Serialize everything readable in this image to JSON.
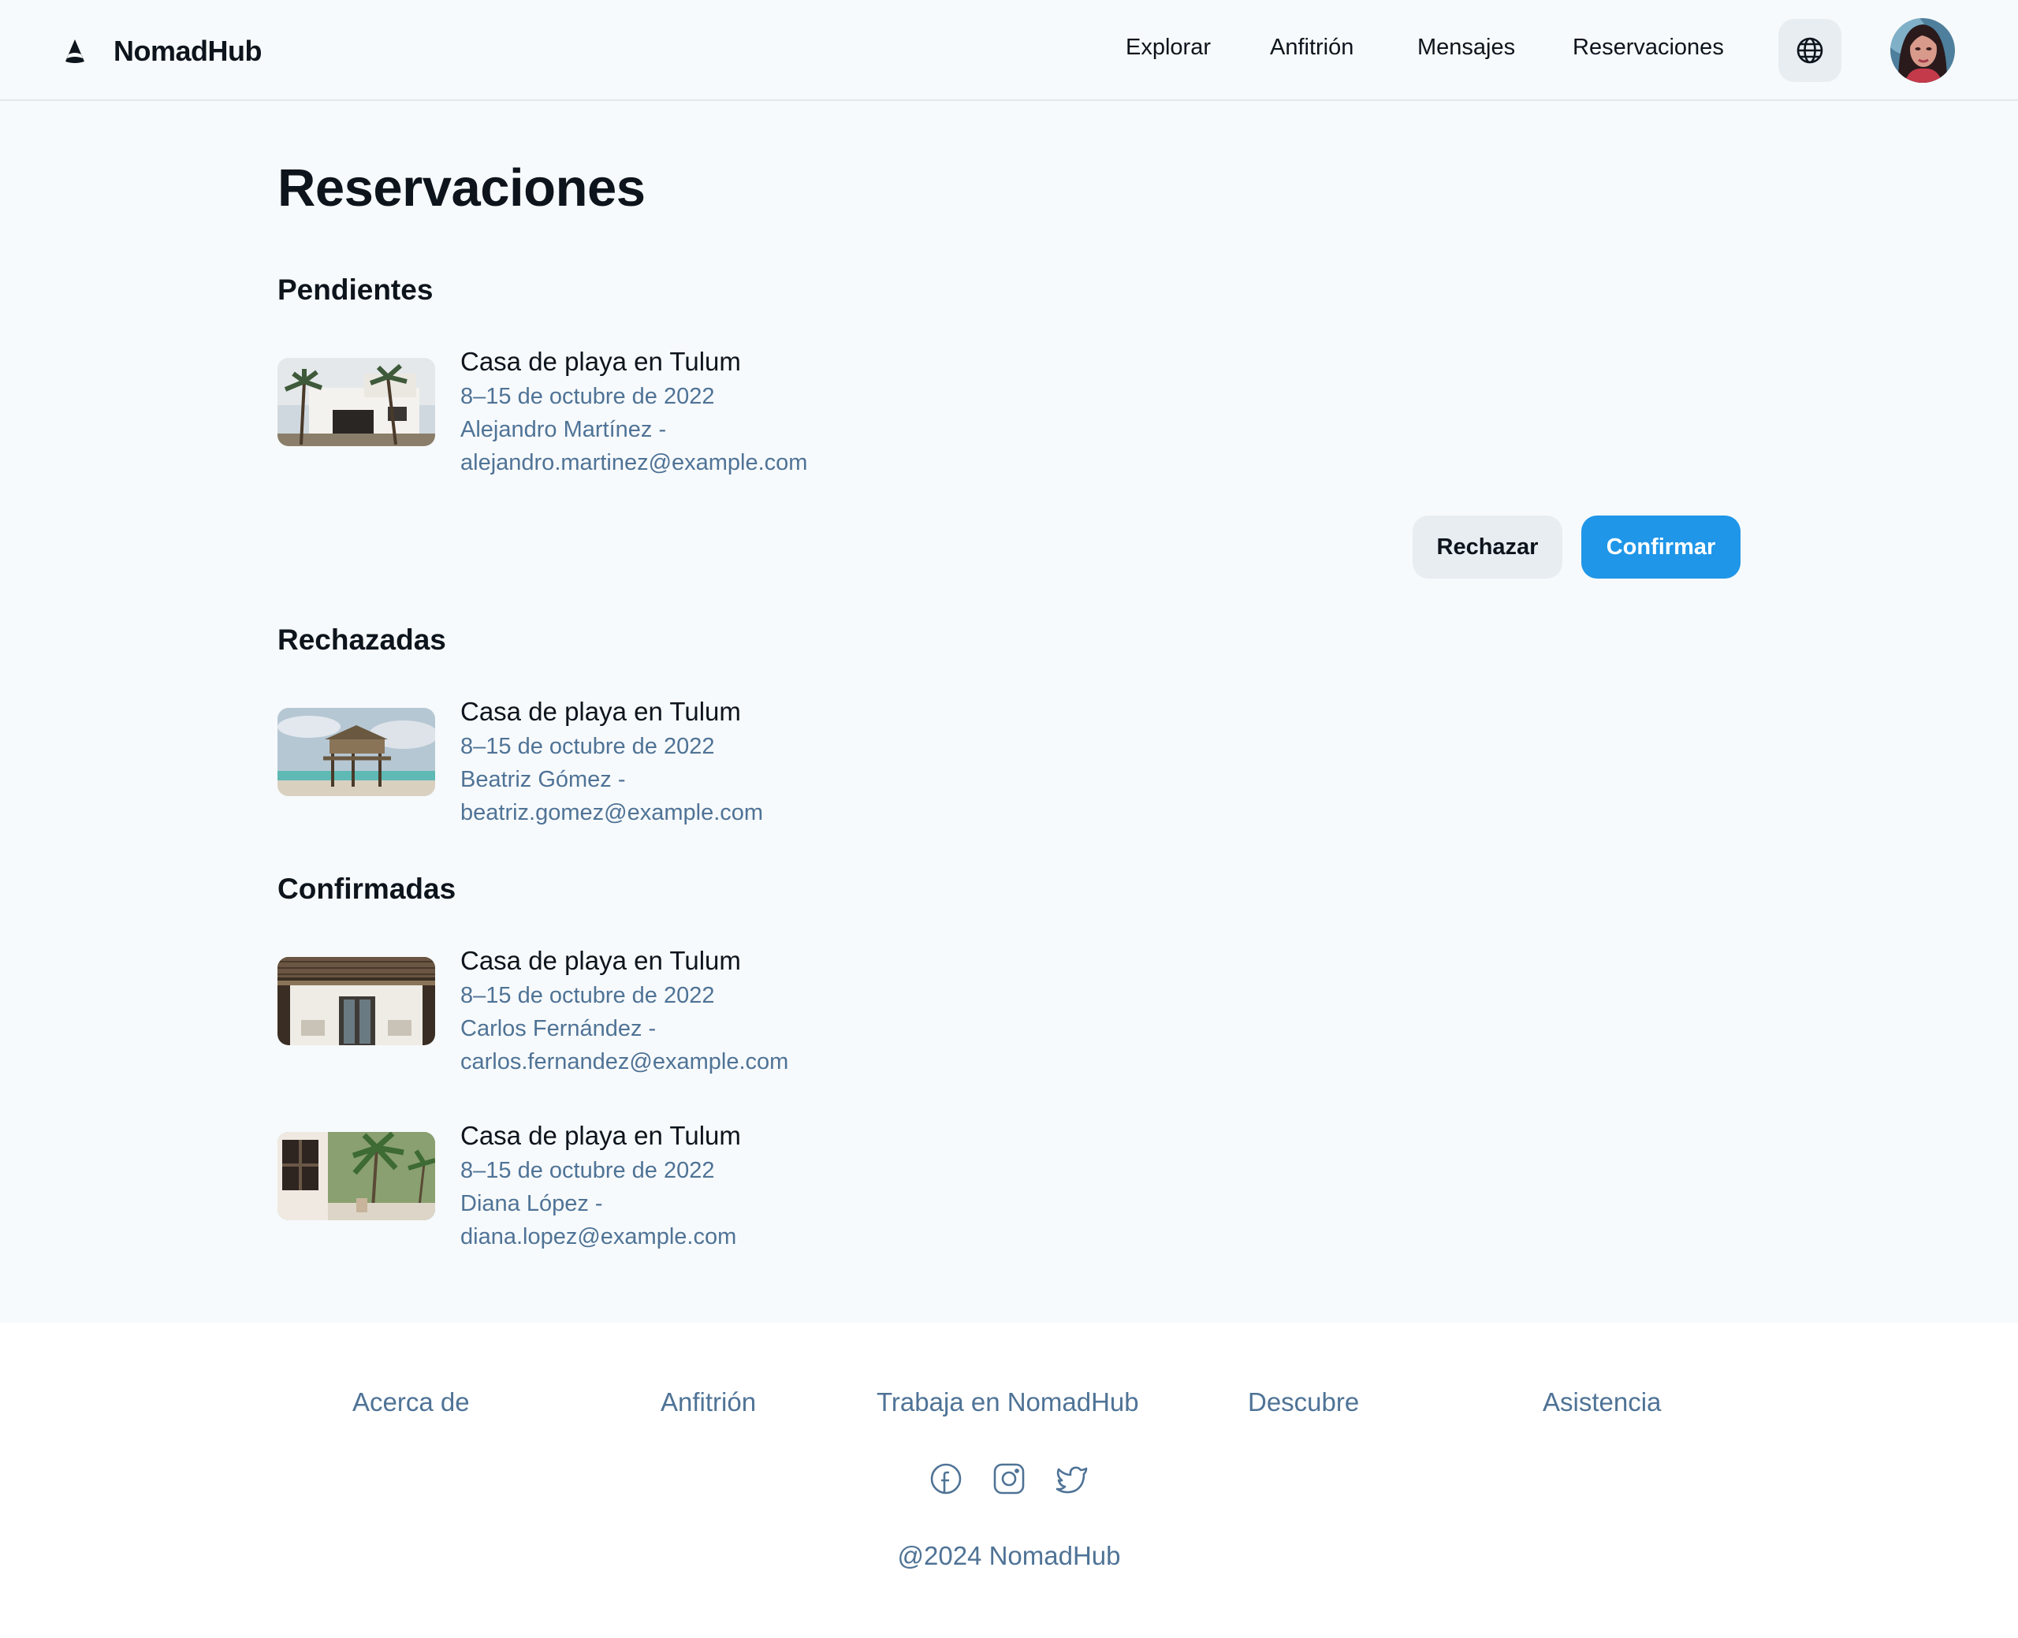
{
  "header": {
    "brand": "NomadHub",
    "nav": [
      "Explorar",
      "Anfitrión",
      "Mensajes",
      "Reservaciones"
    ],
    "icons": {
      "logo": "logo-icon",
      "language": "globe-icon",
      "profile": "avatar"
    }
  },
  "main": {
    "title": "Reservaciones",
    "sections": {
      "pending": {
        "title": "Pendientes",
        "items": [
          {
            "property": "Casa de playa en Tulum",
            "dates": "8–15 de octubre de 2022",
            "guest": "Alejandro Martínez -",
            "email": "alejandro.martinez@example.com"
          }
        ],
        "actions": {
          "reject": "Rechazar",
          "confirm": "Confirmar"
        }
      },
      "rejected": {
        "title": "Rechazadas",
        "items": [
          {
            "property": "Casa de playa en Tulum",
            "dates": "8–15 de octubre de 2022",
            "guest": "Beatriz Gómez -",
            "email": "beatriz.gomez@example.com"
          }
        ]
      },
      "confirmed": {
        "title": "Confirmadas",
        "items": [
          {
            "property": "Casa de playa en Tulum",
            "dates": "8–15 de octubre de 2022",
            "guest": "Carlos Fernández -",
            "email": "carlos.fernandez@example.com"
          },
          {
            "property": "Casa de playa en Tulum",
            "dates": "8–15 de octubre de 2022",
            "guest": "Diana López -",
            "email": "diana.lopez@example.com"
          }
        ]
      }
    }
  },
  "footer": {
    "links": [
      "Acerca de",
      "Anfitrión",
      "Trabaja en NomadHub",
      "Descubre",
      "Asistencia"
    ],
    "social": [
      "facebook-icon",
      "instagram-icon",
      "twitter-icon"
    ],
    "copyright": "@2024 NomadHub"
  },
  "colors": {
    "background": "#f7fafc",
    "text": "#0d141c",
    "muted": "#4f7396",
    "primary": "#1f96e8",
    "secondary_button": "#e8edf2"
  }
}
